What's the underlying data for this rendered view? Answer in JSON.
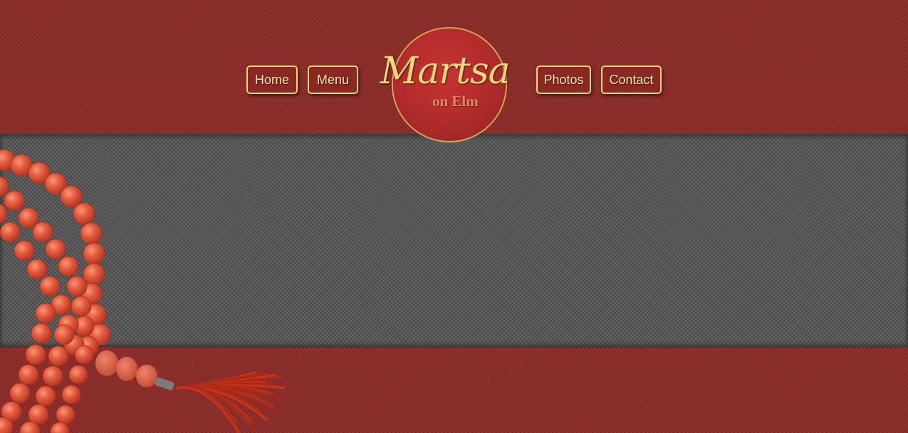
{
  "nav": {
    "items": [
      {
        "label": "Home"
      },
      {
        "label": "Menu"
      },
      {
        "label": "Photos"
      },
      {
        "label": "Contact"
      }
    ]
  },
  "logo": {
    "title": "Martsa",
    "subtitle": "on Elm"
  },
  "colors": {
    "brand_red": "#8e2b28",
    "content_gray": "#575757",
    "gold": "#f2d873",
    "bead": "#e35a3c"
  },
  "decor": {
    "icon": "prayer-beads-icon"
  }
}
